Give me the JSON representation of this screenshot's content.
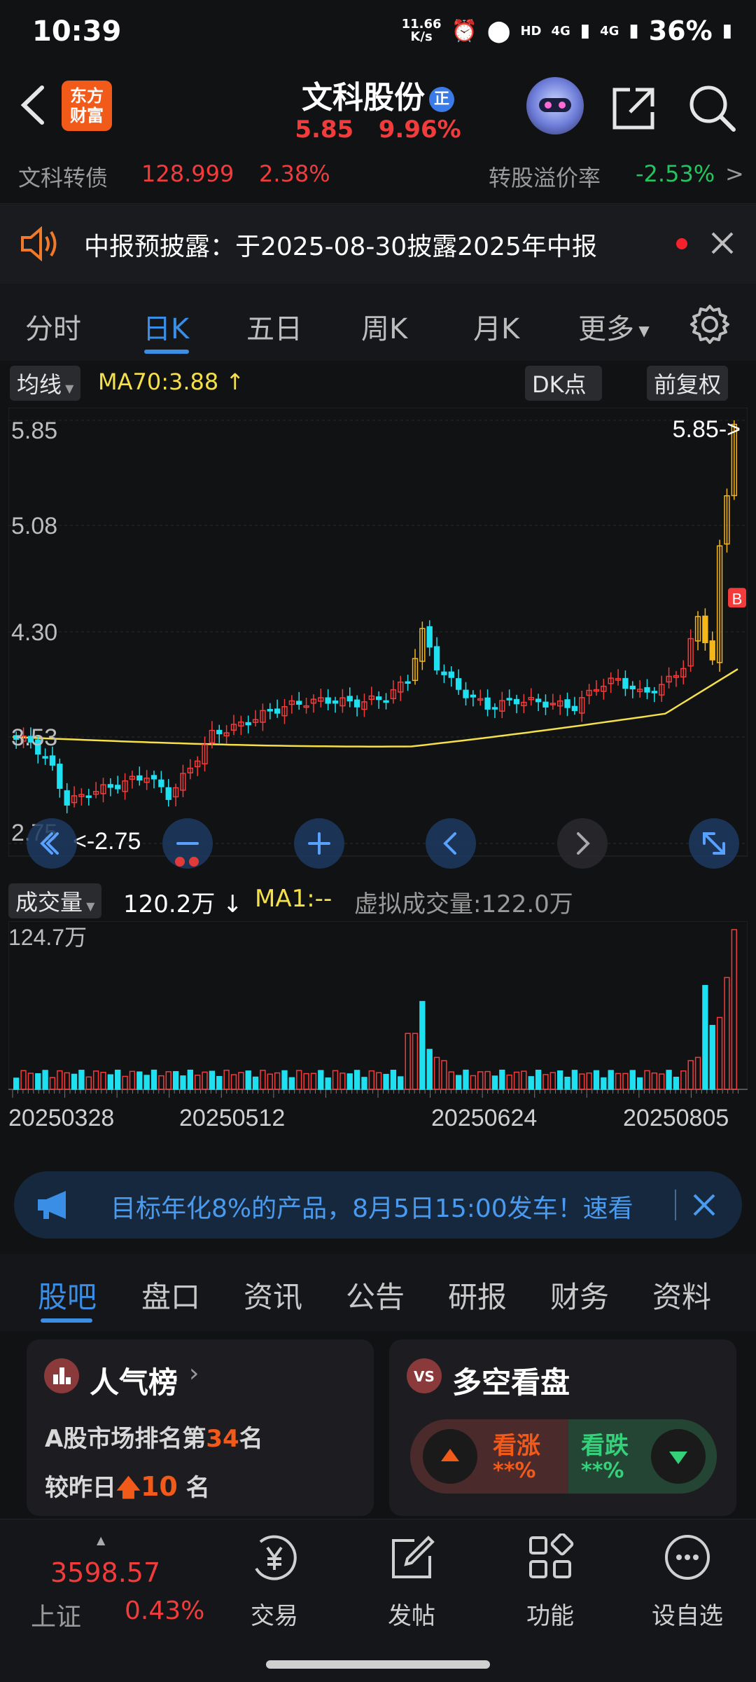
{
  "status_bar": {
    "time": "10:39",
    "net_speed_value": "11.66",
    "net_speed_unit": "K/s",
    "hd": "HD",
    "net1": "4G",
    "net2": "4G",
    "battery": "36%"
  },
  "header": {
    "brand_line1": "东方",
    "brand_line2": "财富",
    "stock_name": "文科股份",
    "badge": "正",
    "price": "5.85",
    "change_pct": "9.96%"
  },
  "bond_row": {
    "bond_name": "文科转债",
    "bond_price": "128.999",
    "bond_change": "2.38%",
    "premium_label": "转股溢价率",
    "premium_value": "-2.53%",
    "more": ">"
  },
  "notice": {
    "text": "中报预披露：于2025-08-30披露2025年中报"
  },
  "period_tabs": [
    "分时",
    "日K",
    "五日",
    "周K",
    "月K",
    "更多"
  ],
  "chart_toolbar": {
    "ma_selector": "均线",
    "ma_value": "MA70:3.88",
    "ma_arrow": "↑",
    "dk_button": "DK点",
    "adjust_button": "前复权"
  },
  "kline": {
    "y_labels": [
      "5.85",
      "5.08",
      "4.30",
      "3.53",
      "2.75"
    ],
    "last_price_marker": "5.85->",
    "low_marker": "<-2.75",
    "b_marker": "B"
  },
  "volume": {
    "selector": "成交量",
    "value": "120.2万",
    "arrow": "↓",
    "ma1": "MA1:--",
    "virtual": "虚拟成交量:122.0万",
    "y_max": "124.7万",
    "dates": [
      "20250328",
      "20250512",
      "20250624",
      "20250805"
    ]
  },
  "ad_banner": {
    "text": "目标年化8%的产品，8月5日15:00发车！速看"
  },
  "section_tabs": [
    "股吧",
    "盘口",
    "资讯",
    "公告",
    "研报",
    "财务",
    "资料"
  ],
  "popularity_card": {
    "title": "人气榜",
    "rank_prefix": "A股市场排名第",
    "rank": "34",
    "rank_suffix": "名",
    "vs_prefix": "较昨日",
    "vs_change": "10",
    "vs_suffix": "名"
  },
  "sentiment_card": {
    "title": "多空看盘",
    "vs_icon": "VS",
    "bull_label": "看涨",
    "bull_value": "**%",
    "bear_label": "看跌",
    "bear_value": "**%"
  },
  "bottom_nav": {
    "index_value": "3598.57",
    "index_name": "上证",
    "index_change": "0.43%",
    "items": [
      "交易",
      "发帖",
      "功能",
      "设自选"
    ]
  },
  "colors": {
    "up": "#f23c3c",
    "down": "#1fe0f0",
    "ma_line": "#f5e04a",
    "accent_blue": "#3a8ee6"
  }
}
